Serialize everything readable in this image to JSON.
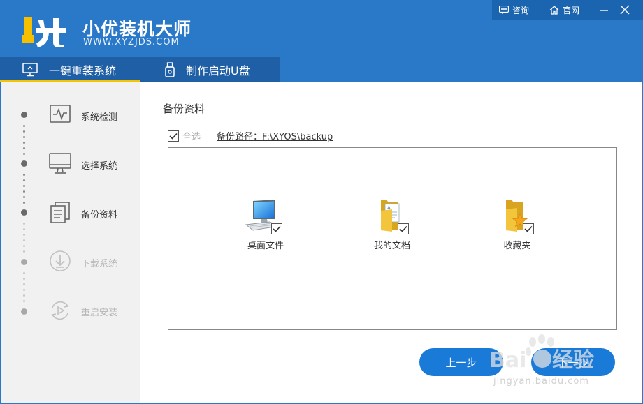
{
  "header": {
    "brand_name": "小优装机大师",
    "brand_url": "WWW.XYZJDS.COM",
    "consult_label": "咨询",
    "website_label": "官网",
    "brand_color": "#2a78c8"
  },
  "tabs": [
    {
      "label": "一键重装系统",
      "active": true,
      "icon": "monitor-icon"
    },
    {
      "label": "制作启动U盘",
      "active": false,
      "icon": "usb-icon"
    }
  ],
  "steps": [
    {
      "label": "系统检测",
      "state": "done",
      "icon": "pulse-monitor-icon"
    },
    {
      "label": "选择系统",
      "state": "done",
      "icon": "desktop-icon"
    },
    {
      "label": "备份资料",
      "state": "current",
      "icon": "documents-icon"
    },
    {
      "label": "下载系统",
      "state": "pending",
      "icon": "download-icon"
    },
    {
      "label": "重启安装",
      "state": "pending",
      "icon": "restart-icon"
    }
  ],
  "main": {
    "section_title": "备份资料",
    "select_all_label": "全选",
    "select_all_checked": true,
    "backup_path": "备份路径：F:\\XYOS\\backup",
    "items": [
      {
        "label": "桌面文件",
        "checked": true,
        "icon": "computer-icon"
      },
      {
        "label": "我的文档",
        "checked": true,
        "icon": "documents-folder-icon"
      },
      {
        "label": "收藏夹",
        "checked": true,
        "icon": "favorites-folder-icon"
      }
    ]
  },
  "buttons": {
    "prev_label": "上一步",
    "next_label": "下一步",
    "button_color": "#1a7ad8"
  },
  "watermark": {
    "text": "jingyan.baidu.com"
  }
}
